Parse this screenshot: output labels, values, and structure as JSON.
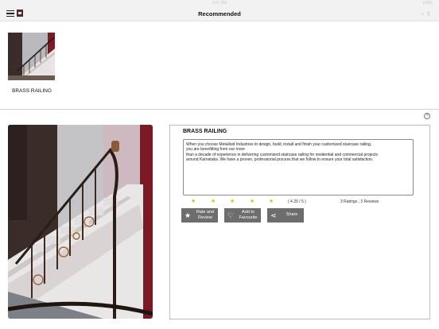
{
  "status_bar": {
    "time": "3:51 PM",
    "battery": "100%"
  },
  "navbar": {
    "title": "Recommended",
    "search_icon": "search-icon",
    "share_icon": "share-icon"
  },
  "recommended": [
    {
      "label": "BRASS RAILING"
    }
  ],
  "product": {
    "title": "BRASS RAILING",
    "description_lines": [
      "When you choose Metalloid Industries to design, build, install and finish your customized staircase railing,",
      "you are benefitting from our more",
      "than a decade of experience in delivering customized staircase railing for residential and commercial projects",
      "around Karnataka. We have a proven, professional process that we follow to ensure your total satisfaction."
    ],
    "rating": {
      "stars": 5,
      "filled": 4.2,
      "score_text": "( 4.20 / 5 )",
      "count_text": "3 Ratings , 3 Reviews"
    },
    "buttons": {
      "rate_line1": "Rate and",
      "rate_line2": "Review",
      "fav_line1": "Add to",
      "fav_line2": "Favourite",
      "share": "Share"
    }
  },
  "help": {
    "label": "?"
  },
  "colors": {
    "star": "#e8b800",
    "button": "#6d6d6d",
    "navbar": "#f2f2f2",
    "logo": "#6b1f24"
  }
}
